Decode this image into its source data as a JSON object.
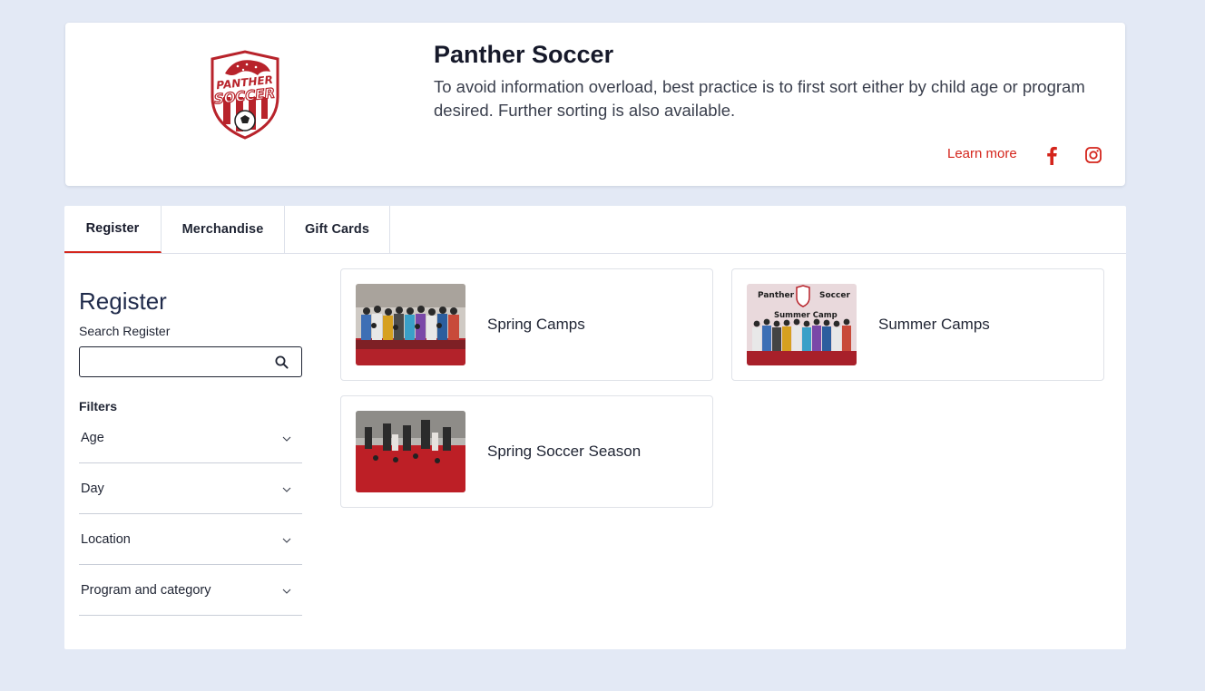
{
  "org": {
    "name": "Panther Soccer",
    "description": "To avoid information overload, best practice is to first sort either by child age or program desired. Further sorting is also available.",
    "learn_more": "Learn more",
    "logo_text": [
      "PANTHER",
      "SOCCER"
    ]
  },
  "colors": {
    "accent": "#d4251c",
    "background": "#e3e9f5",
    "title": "#1f2a4a"
  },
  "tabs": [
    {
      "label": "Register",
      "active": true
    },
    {
      "label": "Merchandise",
      "active": false
    },
    {
      "label": "Gift Cards",
      "active": false
    }
  ],
  "sidebar": {
    "title": "Register",
    "search_label": "Search Register",
    "search_value": "",
    "filters_label": "Filters",
    "filters": [
      {
        "label": "Age"
      },
      {
        "label": "Day"
      },
      {
        "label": "Location"
      },
      {
        "label": "Program and category"
      }
    ]
  },
  "programs": [
    {
      "name": "Spring Camps"
    },
    {
      "name": "Summer Camps",
      "image_text": [
        "Panther",
        "Soccer",
        "Summer Camp"
      ]
    },
    {
      "name": "Spring Soccer Season"
    }
  ],
  "icons": {
    "search": "search-icon",
    "facebook": "facebook-icon",
    "instagram": "instagram-icon",
    "chevron": "chevron-down-icon"
  }
}
